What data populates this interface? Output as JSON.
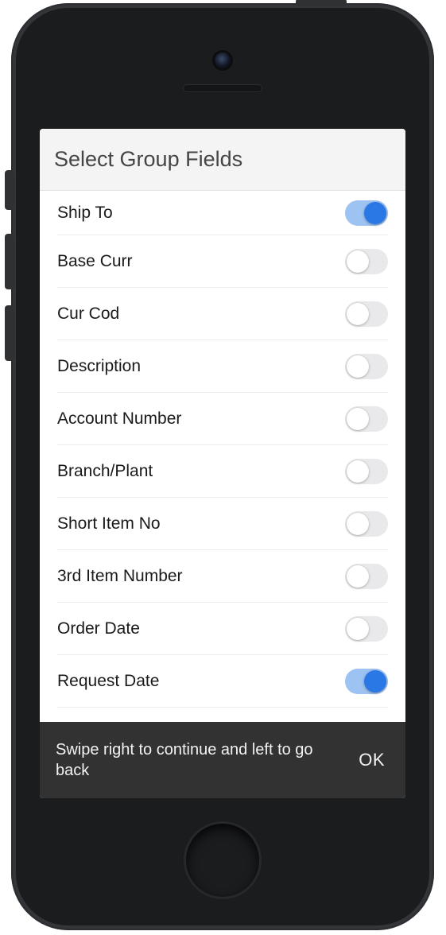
{
  "header": {
    "title": "Select Group Fields"
  },
  "fields": [
    {
      "label": "Ship To",
      "on": true
    },
    {
      "label": "Base Curr",
      "on": false
    },
    {
      "label": "Cur Cod",
      "on": false
    },
    {
      "label": "Description",
      "on": false
    },
    {
      "label": "Account Number",
      "on": false
    },
    {
      "label": "Branch/Plant",
      "on": false
    },
    {
      "label": "Short Item No",
      "on": false
    },
    {
      "label": "3rd Item Number",
      "on": false
    },
    {
      "label": "Order Date",
      "on": false
    },
    {
      "label": "Request Date",
      "on": true
    }
  ],
  "footer": {
    "hint": "Swipe right to continue and left to go back",
    "ok_label": "OK"
  },
  "colors": {
    "switch_on_track": "#9dc3f3",
    "switch_on_knob": "#2a77e6",
    "switch_off_track": "#e9e9ec",
    "header_bg": "#f4f4f4",
    "footer_bg": "#323232"
  }
}
